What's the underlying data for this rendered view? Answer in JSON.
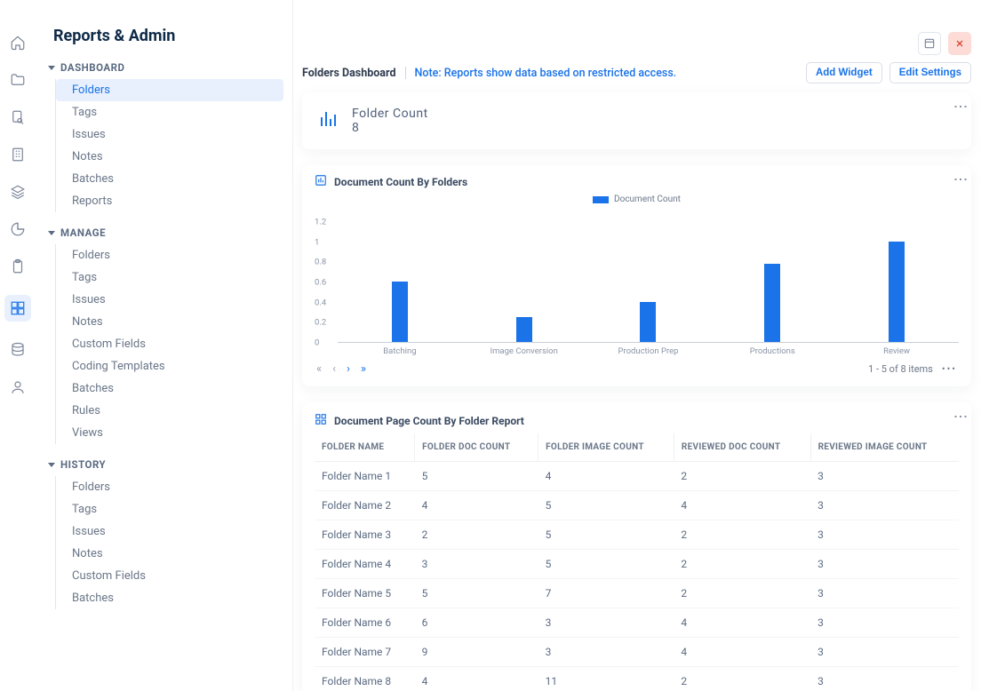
{
  "page_title": "Reports & Admin",
  "sidebar": {
    "sections": [
      {
        "label": "DASHBOARD",
        "items": [
          "Folders",
          "Tags",
          "Issues",
          "Notes",
          "Batches",
          "Reports"
        ],
        "active_index": 0
      },
      {
        "label": "MANAGE",
        "items": [
          "Folders",
          "Tags",
          "Issues",
          "Notes",
          "Custom Fields",
          "Coding Templates",
          "Batches",
          "Rules",
          "Views"
        ]
      },
      {
        "label": "HISTORY",
        "items": [
          "Folders",
          "Tags",
          "Issues",
          "Notes",
          "Custom Fields",
          "Batches"
        ]
      }
    ]
  },
  "header": {
    "title": "Folders Dashboard",
    "note": "Note: Reports show data based on restricted access.",
    "add_widget": "Add Widget",
    "edit_settings": "Edit Settings"
  },
  "folder_count": {
    "title": "Folder Count",
    "value": "8"
  },
  "chart_data": {
    "type": "bar",
    "title": "Document Count By Folders",
    "legend": "Document Count",
    "categories": [
      "Batching",
      "Image Conversion",
      "Production Prep",
      "Productions",
      "Review"
    ],
    "values": [
      0.6,
      0.25,
      0.4,
      0.78,
      1.0
    ],
    "ylim": [
      0,
      1.2
    ],
    "yticks": [
      0,
      0.2,
      0.4,
      0.6,
      0.8,
      1,
      1.2
    ],
    "pager_info": "1 - 5 of 8 items"
  },
  "table": {
    "title": "Document Page Count By Folder Report",
    "columns": [
      "FOLDER NAME",
      "FOLDER DOC COUNT",
      "FOLDER IMAGE COUNT",
      "REVIEWED DOC COUNT",
      "REVIEWED IMAGE COUNT"
    ],
    "rows": [
      [
        "Folder Name 1",
        "5",
        "4",
        "2",
        "3"
      ],
      [
        "Folder Name 2",
        "4",
        "5",
        "4",
        "3"
      ],
      [
        "Folder Name 3",
        "2",
        "5",
        "2",
        "3"
      ],
      [
        "Folder Name 4",
        "3",
        "5",
        "2",
        "3"
      ],
      [
        "Folder Name 5",
        "5",
        "7",
        "2",
        "3"
      ],
      [
        "Folder Name 6",
        "6",
        "3",
        "4",
        "3"
      ],
      [
        "Folder Name 7",
        "9",
        "3",
        "4",
        "3"
      ],
      [
        "Folder Name 8",
        "4",
        "11",
        "2",
        "3"
      ]
    ]
  }
}
